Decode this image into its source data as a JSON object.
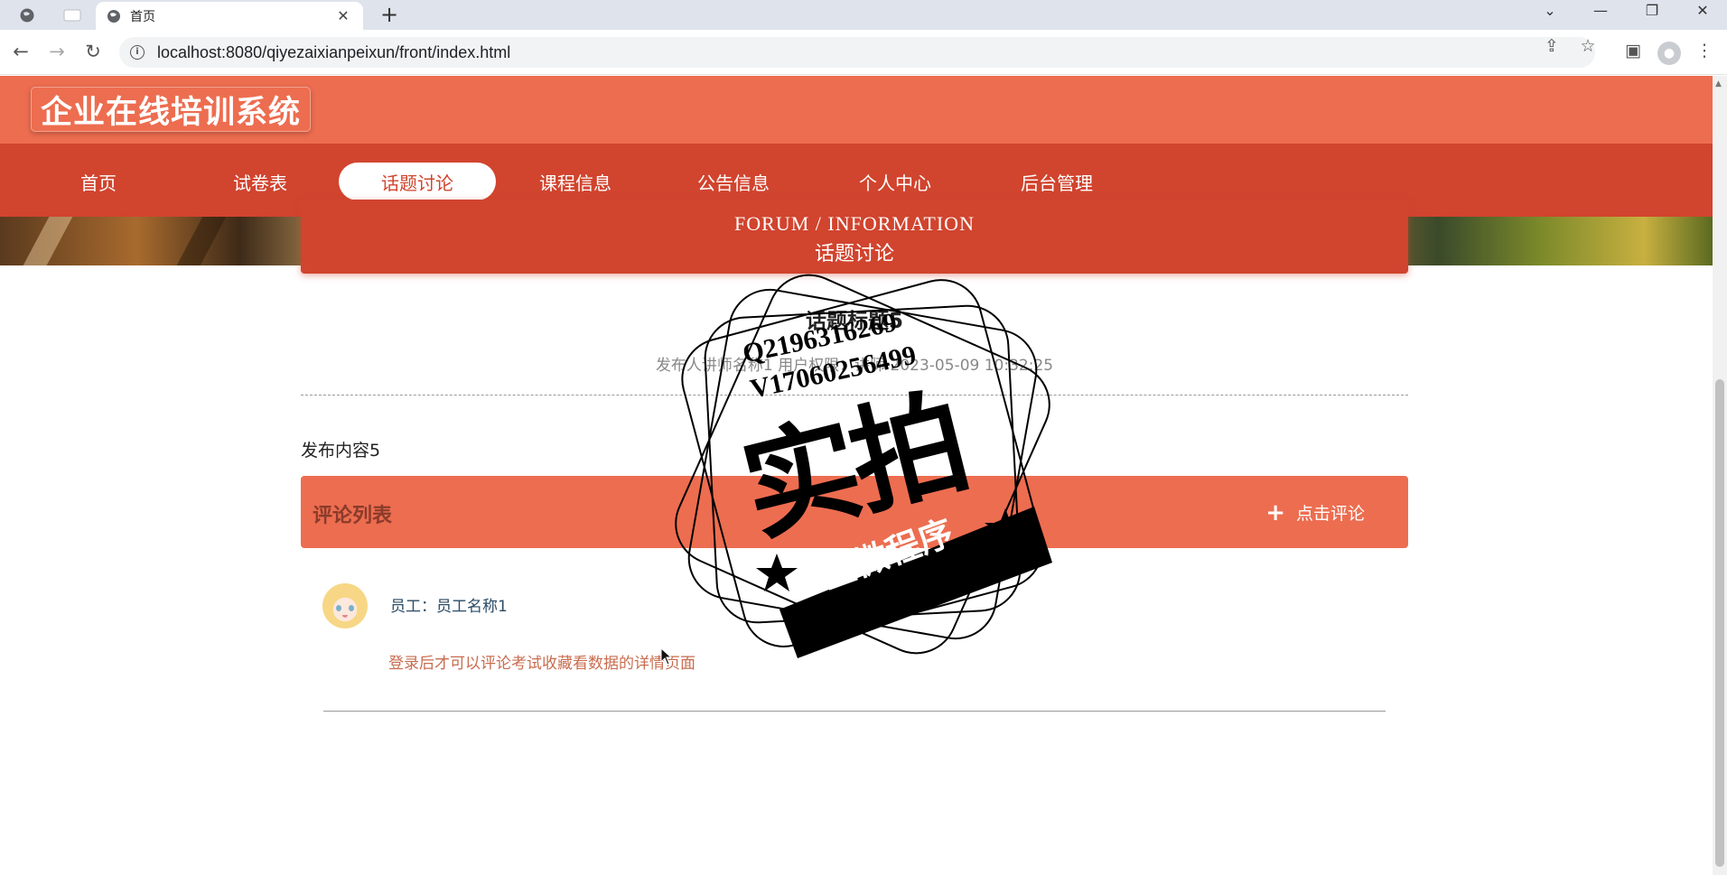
{
  "browser": {
    "tab_title": "首页",
    "url": "localhost:8080/qiyezaixianpeixun/front/index.html"
  },
  "site": {
    "logo": "企业在线培训系统",
    "nav": [
      "首页",
      "试卷表",
      "话题讨论",
      "课程信息",
      "公告信息",
      "个人中心",
      "后台管理"
    ],
    "active_nav": "话题讨论"
  },
  "forum": {
    "heading_en": "FORUM / INFORMATION",
    "heading_cn": "话题讨论"
  },
  "post": {
    "title": "话题标题5",
    "meta": "发布人讲师名称1 用户权限：讲师 2023-05-09 10:32:25",
    "content": "发布内容5"
  },
  "comments": {
    "title": "评论列表",
    "add_label": "点击评论",
    "items": [
      {
        "user": "员工：员工名称1",
        "body": "登录后才可以评论考试收藏看数据的详情页面"
      }
    ]
  },
  "watermark": {
    "lines": [
      "Q2196316269",
      "V17060256499"
    ],
    "big": "实拍",
    "ribbon": "全微程序"
  },
  "colors": {
    "header": "#ed6d50",
    "nav": "#d1442e",
    "comment_text": "#c96c4f"
  }
}
